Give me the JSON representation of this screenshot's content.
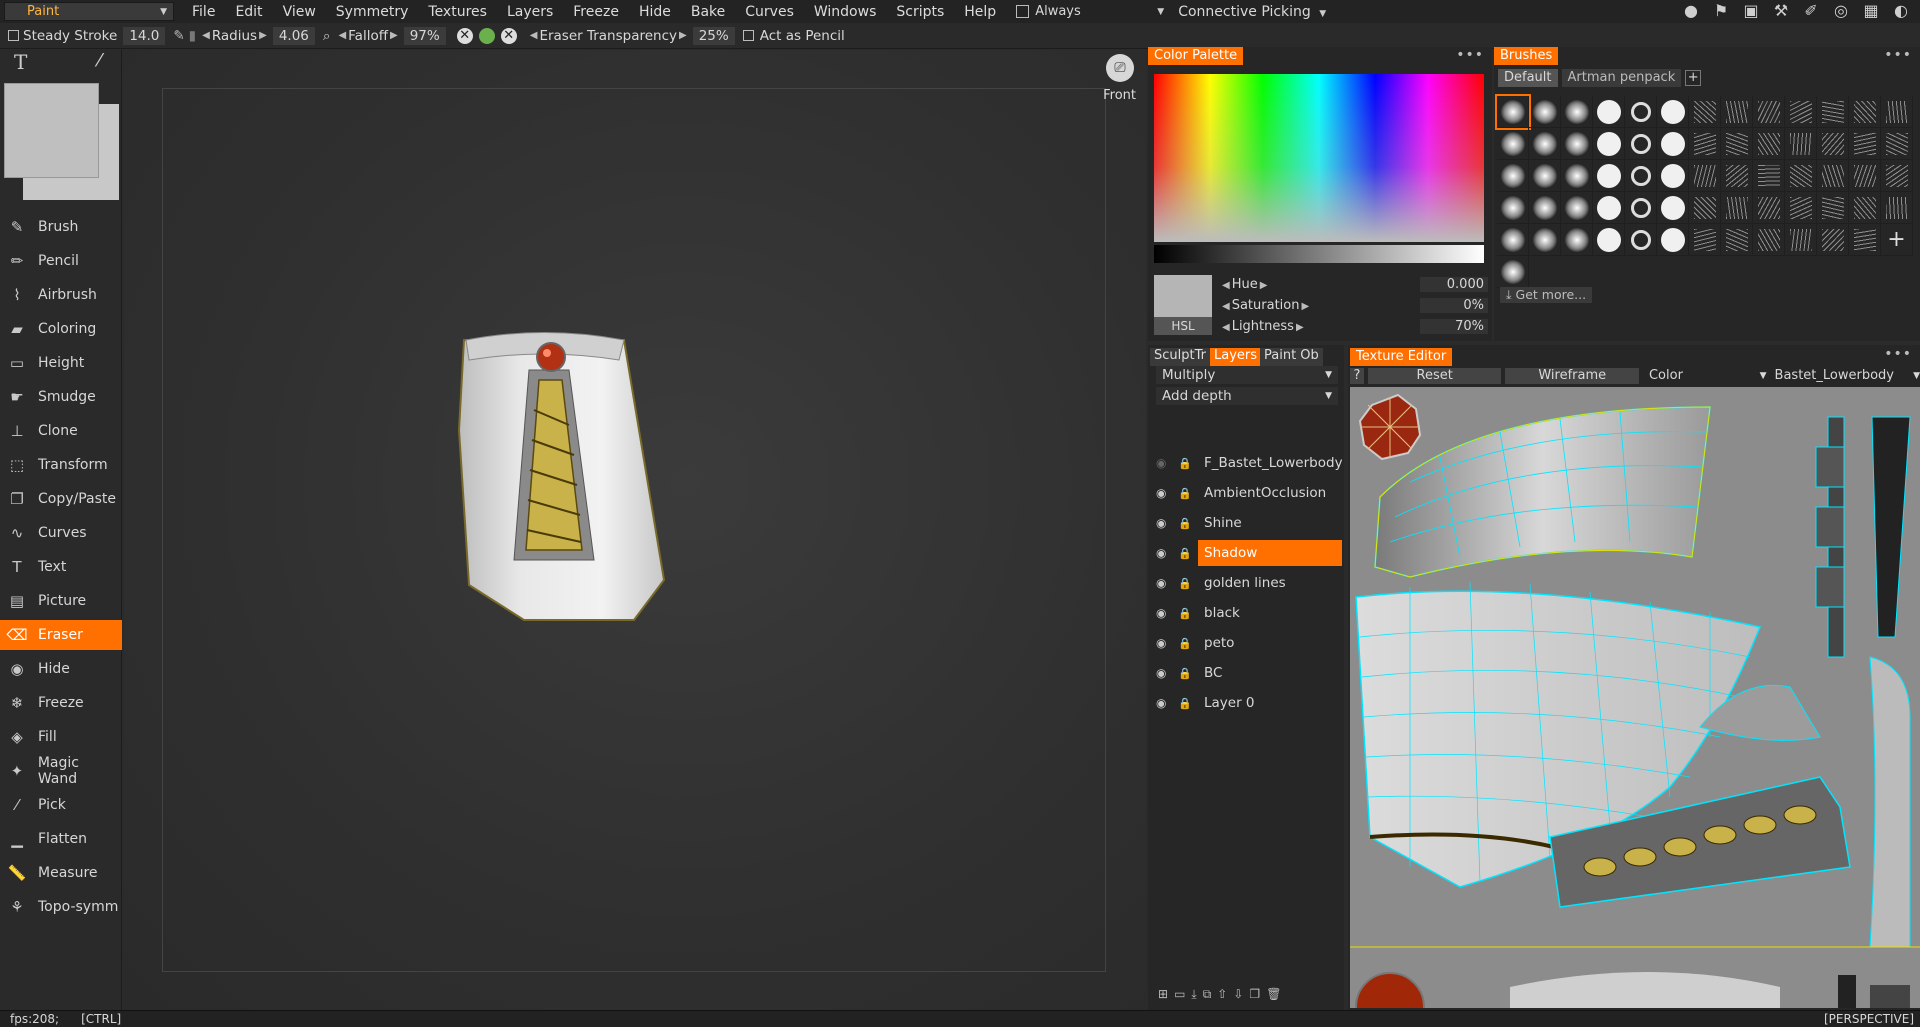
{
  "menubar": {
    "mode": "Paint",
    "items": [
      "File",
      "Edit",
      "View",
      "Symmetry",
      "Textures",
      "Layers",
      "Freeze",
      "Hide",
      "Bake",
      "Curves",
      "Windows",
      "Scripts",
      "Help"
    ],
    "always_label": "Always",
    "connective_picking": "Connective  Picking"
  },
  "optbar": {
    "steady_stroke": "Steady  Stroke",
    "steady_value": "14.0",
    "radius_label": "Radius",
    "radius_value": "4.06",
    "falloff_label": "Falloff",
    "falloff_value": "97%",
    "eraser_transparency_label": "Eraser  Transparency",
    "eraser_transparency_value": "25%",
    "act_as_pencil": "Act  as  Pencil"
  },
  "tools": [
    {
      "label": "Brush",
      "icon": "brush-icon",
      "glyph": "✎"
    },
    {
      "label": "Pencil",
      "icon": "pencil-icon",
      "glyph": "✏"
    },
    {
      "label": "Airbrush",
      "icon": "airbrush-icon",
      "glyph": "⌇"
    },
    {
      "label": "Coloring",
      "icon": "coloring-icon",
      "glyph": "▰"
    },
    {
      "label": "Height",
      "icon": "height-icon",
      "glyph": "▭"
    },
    {
      "label": "Smudge",
      "icon": "smudge-icon",
      "glyph": "☛"
    },
    {
      "label": "Clone",
      "icon": "clone-icon",
      "glyph": "⊥"
    },
    {
      "label": "Transform",
      "icon": "transform-icon",
      "glyph": "⬚"
    },
    {
      "label": "Copy/Paste",
      "icon": "copy-paste-icon",
      "glyph": "❐"
    },
    {
      "label": "Curves",
      "icon": "curves-icon",
      "glyph": "∿"
    },
    {
      "label": "Text",
      "icon": "text-icon",
      "glyph": "T"
    },
    {
      "label": "Picture",
      "icon": "picture-icon",
      "glyph": "▤"
    },
    {
      "label": "Eraser",
      "icon": "eraser-icon",
      "glyph": "⌫"
    },
    {
      "label": "Hide",
      "icon": "hide-icon",
      "glyph": "◉"
    },
    {
      "label": "Freeze",
      "icon": "freeze-icon",
      "glyph": "❄"
    },
    {
      "label": "Fill",
      "icon": "fill-icon",
      "glyph": "◈"
    },
    {
      "label": "Magic  Wand",
      "icon": "magic-wand-icon",
      "glyph": "✦"
    },
    {
      "label": "Pick",
      "icon": "pick-icon",
      "glyph": "⁄"
    },
    {
      "label": "Flatten",
      "icon": "flatten-icon",
      "glyph": "▁"
    },
    {
      "label": "Measure",
      "icon": "measure-icon",
      "glyph": "📏"
    },
    {
      "label": "Topo-symm",
      "icon": "topo-symm-icon",
      "glyph": "⚘"
    }
  ],
  "active_tool": "Eraser",
  "viewport": {
    "camera_view": "Front"
  },
  "color_palette": {
    "title": "Color Palette",
    "mode": "HSL",
    "hue_label": "Hue",
    "hue_value": "0.000",
    "saturation_label": "Saturation",
    "saturation_value": "0%",
    "lightness_label": "Lightness",
    "lightness_value": "70%"
  },
  "brushes": {
    "title": "Brushes",
    "tabs": [
      "Default",
      "Artman  penpack"
    ],
    "get_more": "Get  more..."
  },
  "layers_panel": {
    "tabs": [
      "SculptTr",
      "Layers",
      "Paint  Ob"
    ],
    "blend_mode": "Multiply",
    "depth_mode": "Add  depth",
    "layers": [
      "F_Bastet_Lowerbody_L",
      "AmbientOcclusion",
      "Shine",
      "Shadow",
      "golden  lines",
      "black",
      "peto",
      "BC",
      "Layer  0"
    ],
    "selected": "Shadow"
  },
  "texture_editor": {
    "title": "Texture  Editor",
    "help": "?",
    "reset": "Reset",
    "wireframe": "Wireframe",
    "channel": "Color",
    "texture": "Bastet_Lowerbody"
  },
  "statusbar": {
    "fps": "fps:208;",
    "ctrl": "[CTRL]",
    "projection": "[PERSPECTIVE]"
  },
  "colors": {
    "accent": "#ff7000",
    "background": "#2b2b2b"
  }
}
